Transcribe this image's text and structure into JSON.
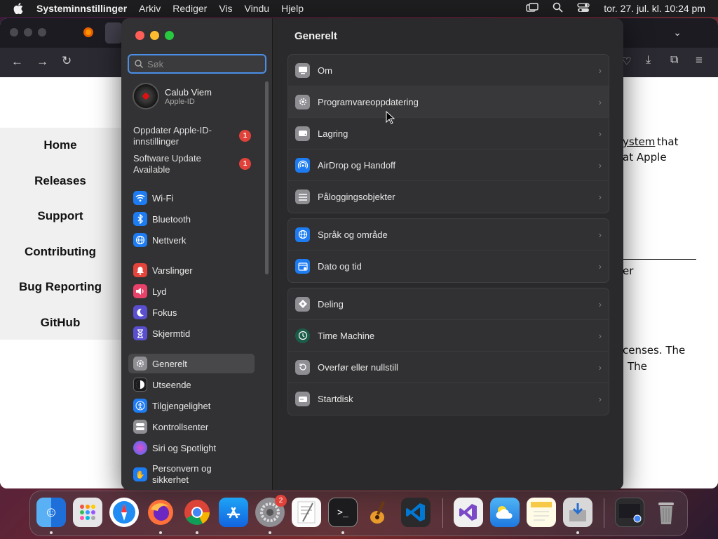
{
  "menubar": {
    "app": "Systeminnstillinger",
    "items": [
      "Arkiv",
      "Rediger",
      "Vis",
      "Vindu",
      "Hjelp"
    ],
    "clock": "tor. 27. jul. kl. 10:24 pm"
  },
  "web": {
    "nav": [
      "Home",
      "Releases",
      "Support",
      "Contributing",
      "Bug Reporting",
      "GitHub"
    ],
    "fragments": [
      "ystem",
      "that",
      "at Apple",
      "er",
      "censes. The",
      "The"
    ]
  },
  "sidebar": {
    "search_placeholder": "Søk",
    "profile_name": "Calub Viem",
    "profile_sub": "Apple-ID",
    "notices": [
      {
        "label": "Oppdater Apple-ID-innstillinger",
        "count": "1"
      },
      {
        "label": "Software Update Available",
        "count": "1"
      }
    ],
    "items": [
      {
        "label": "Wi-Fi",
        "icon": "wifi-icon",
        "color": "#1e7cf2"
      },
      {
        "label": "Bluetooth",
        "icon": "bluetooth-icon",
        "color": "#1e7cf2"
      },
      {
        "label": "Nettverk",
        "icon": "globe-icon",
        "color": "#1e7cf2"
      },
      {
        "label": "Varslinger",
        "icon": "bell-icon",
        "color": "#e5443a"
      },
      {
        "label": "Lyd",
        "icon": "speaker-icon",
        "color": "#e8416a"
      },
      {
        "label": "Fokus",
        "icon": "moon-icon",
        "color": "#5a4fcf"
      },
      {
        "label": "Skjermtid",
        "icon": "hourglass-icon",
        "color": "#5a4fcf"
      },
      {
        "label": "Generelt",
        "icon": "gear-icon",
        "color": "#8e8e93"
      },
      {
        "label": "Utseende",
        "icon": "appearance-icon",
        "color": "#1c1c1e"
      },
      {
        "label": "Tilgjengelighet",
        "icon": "accessibility-icon",
        "color": "#1e7cf2"
      },
      {
        "label": "Kontrollsenter",
        "icon": "control-center-icon",
        "color": "#8e8e93"
      },
      {
        "label": "Siri og Spotlight",
        "icon": "siri-icon",
        "color": "#7b4fd6"
      },
      {
        "label": "Personvern og sikkerhet",
        "icon": "hand-icon",
        "color": "#1e7cf2"
      }
    ]
  },
  "main": {
    "title": "Generelt",
    "groups": [
      [
        {
          "label": "Om",
          "icon": "computer-icon"
        },
        {
          "label": "Programvareoppdatering",
          "icon": "gear-icon"
        },
        {
          "label": "Lagring",
          "icon": "drive-icon"
        },
        {
          "label": "AirDrop og Handoff",
          "icon": "airdrop-icon"
        },
        {
          "label": "Påloggingsobjekter",
          "icon": "list-icon"
        }
      ],
      [
        {
          "label": "Språk og område",
          "icon": "globe-icon"
        },
        {
          "label": "Dato og tid",
          "icon": "calendar-icon"
        }
      ],
      [
        {
          "label": "Deling",
          "icon": "sharing-icon"
        },
        {
          "label": "Time Machine",
          "icon": "time-machine-icon"
        },
        {
          "label": "Overfør eller nullstill",
          "icon": "reset-icon"
        },
        {
          "label": "Startdisk",
          "icon": "startup-disk-icon"
        }
      ]
    ]
  },
  "dock": {
    "settings_badge": "2"
  }
}
